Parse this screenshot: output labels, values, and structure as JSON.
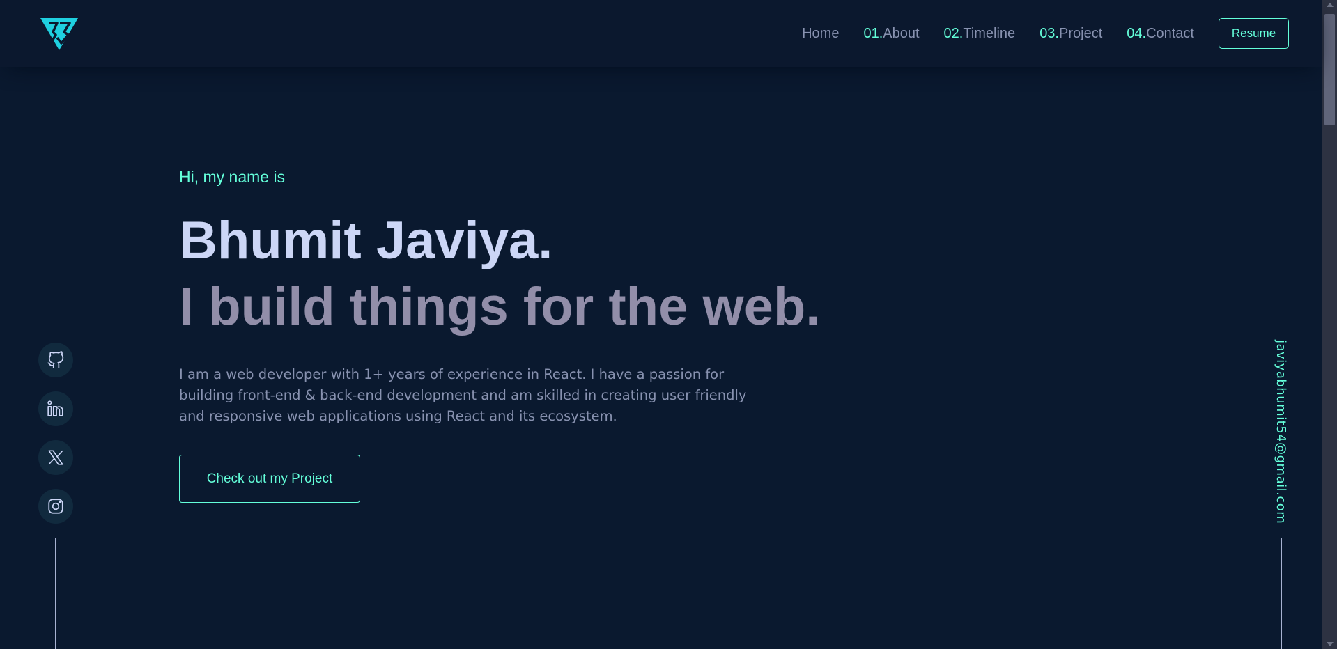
{
  "header": {
    "logo_icon": "jb-triangle-logo-icon",
    "nav": [
      {
        "num": "",
        "label": "Home"
      },
      {
        "num": "01.",
        "label": "About"
      },
      {
        "num": "02.",
        "label": "Timeline"
      },
      {
        "num": "03.",
        "label": "Project"
      },
      {
        "num": "04.",
        "label": "Contact"
      }
    ],
    "resume_label": "Resume"
  },
  "hero": {
    "greeting": "Hi, my name is",
    "name": "Bhumit Javiya.",
    "tagline": "I build things for the web.",
    "bio": "I am a web developer with 1+ years of experience in React. I have a passion for building front-end & back-end development and am skilled in creating user friendly and responsive web applications using React and its ecosystem.",
    "cta_label": "Check out my Project"
  },
  "socials": [
    {
      "icon": "github-icon"
    },
    {
      "icon": "linkedin-icon"
    },
    {
      "icon": "x-twitter-icon"
    },
    {
      "icon": "instagram-icon"
    }
  ],
  "email": "javiyabhumit54@gmail.com",
  "colors": {
    "background": "#0a192f",
    "accent": "#64ffda",
    "heading": "#ccd6f6",
    "tagline": "#928ea9",
    "body_text": "#8892b0"
  }
}
